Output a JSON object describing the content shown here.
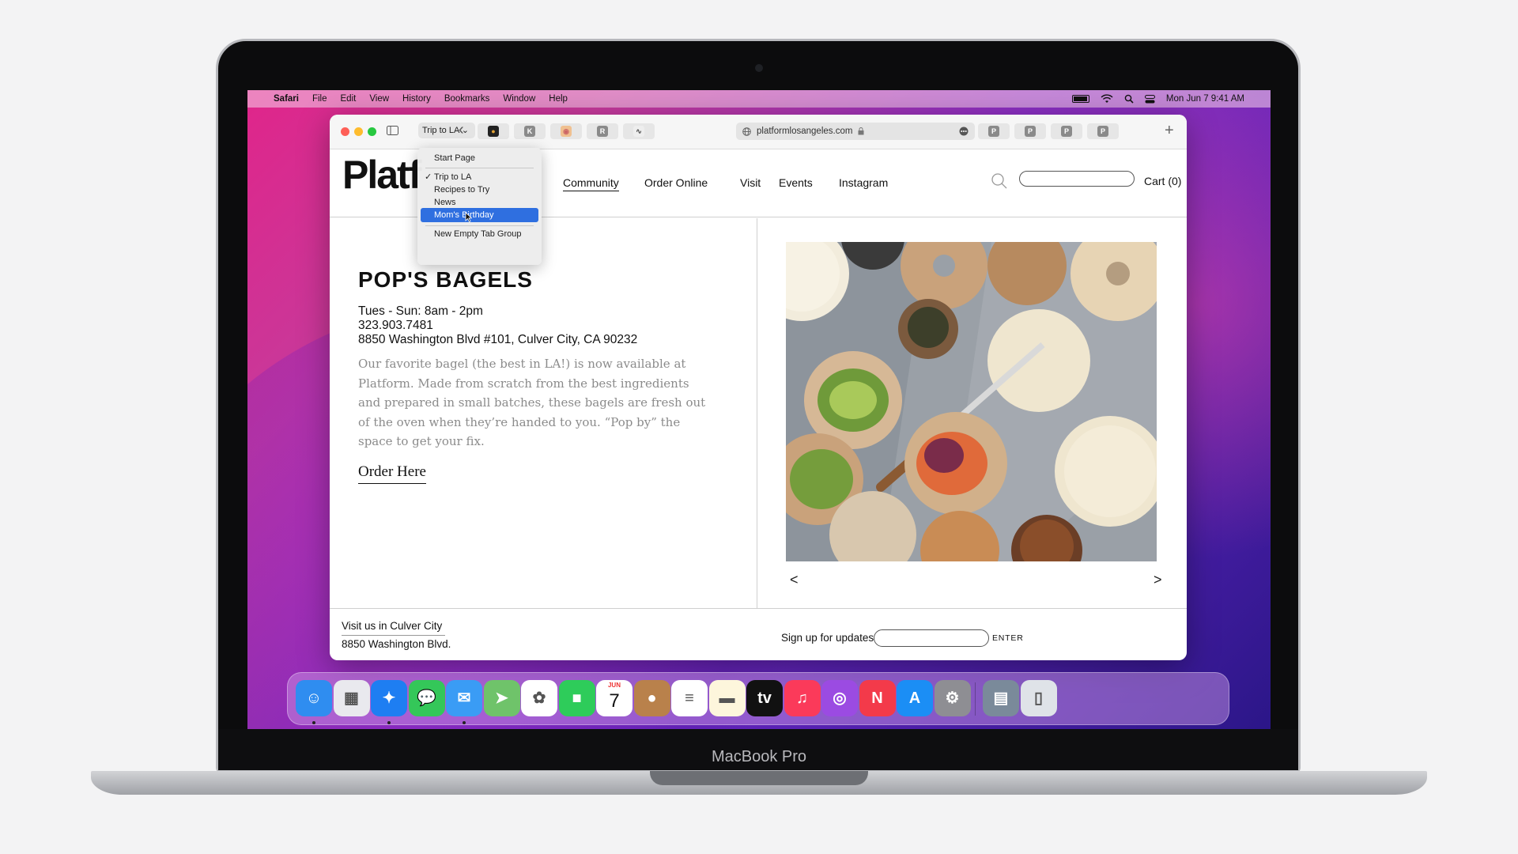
{
  "device": {
    "label": "MacBook Pro"
  },
  "menubar": {
    "apple": "",
    "app": "Safari",
    "items": [
      "File",
      "Edit",
      "View",
      "History",
      "Bookmarks",
      "Window",
      "Help"
    ],
    "datetime": "Mon Jun 7  9:41 AM"
  },
  "toolbar": {
    "tab_group": "Trip to LA",
    "back": "‹",
    "url": "platformlosangeles.com",
    "new_tab": "+",
    "tabs": [
      {
        "icon": "●",
        "color": "#d8a030"
      },
      {
        "icon": "K",
        "color": "#7a7a7a"
      },
      {
        "icon": "◉",
        "color": "#e6a060"
      },
      {
        "icon": "R",
        "color": "#7a7a7a"
      },
      {
        "icon": "∿",
        "color": "#7a7a7a"
      }
    ],
    "right_tabs": [
      "P",
      "P",
      "P",
      "P"
    ]
  },
  "tab_group_menu": {
    "items": [
      {
        "label": "Start Page"
      },
      {
        "label": "Trip to LA",
        "checked": "✓"
      },
      {
        "label": "Recipes to Try"
      },
      {
        "label": "News"
      },
      {
        "label": "Mom's Birthday",
        "highlighted": true
      },
      {
        "label": "New Empty Tab Group"
      }
    ]
  },
  "site": {
    "logo": "Platf",
    "nav": [
      "Community",
      "Order Online",
      "Visit",
      "Events",
      "Instagram"
    ],
    "cart": "Cart (0)",
    "title": "POP'S BAGELS",
    "hours": "Tues - Sun: 8am - 2pm",
    "phone": "323.903.7481",
    "address": "8850 Washington Blvd #101, Culver City, CA 90232",
    "description": "Our favorite bagel (the best in LA!) is now available at Platform. Made from scratch from the best ingredients and prepared in small batches, these bagels are fresh out of the oven when they’re handed to you. “Pop by” the space to get your fix.",
    "order_link": "Order Here",
    "prev": "<",
    "next": ">",
    "footer": {
      "visit": "Visit us in Culver City",
      "street": "8850 Washington Blvd.",
      "signup": "Sign up for updates",
      "enter": "ENTER"
    }
  },
  "dock": {
    "apps": [
      {
        "name": "Finder",
        "glyph": "☺",
        "color": "#2f8df0"
      },
      {
        "name": "Launchpad",
        "glyph": "▦",
        "color": "#e9e9ee"
      },
      {
        "name": "Safari",
        "glyph": "✦",
        "color": "#1e7ef2"
      },
      {
        "name": "Messages",
        "glyph": "💬",
        "color": "#34c759"
      },
      {
        "name": "Mail",
        "glyph": "✉",
        "color": "#3a9cf5"
      },
      {
        "name": "Maps",
        "glyph": "➤",
        "color": "#6fc36a"
      },
      {
        "name": "Photos",
        "glyph": "✿",
        "color": "#ffffff"
      },
      {
        "name": "FaceTime",
        "glyph": "■",
        "color": "#2ecc5a"
      },
      {
        "name": "Calendar",
        "glyph": "7",
        "color": "#ffffff",
        "month": "JUN"
      },
      {
        "name": "Contacts",
        "glyph": "●",
        "color": "#b9814b"
      },
      {
        "name": "Reminders",
        "glyph": "≡",
        "color": "#ffffff"
      },
      {
        "name": "Notes",
        "glyph": "▬",
        "color": "#fdf6dc"
      },
      {
        "name": "TV",
        "glyph": "tv",
        "color": "#111111"
      },
      {
        "name": "Music",
        "glyph": "♫",
        "color": "#fb3a5a"
      },
      {
        "name": "Podcasts",
        "glyph": "◎",
        "color": "#9b4be2"
      },
      {
        "name": "News",
        "glyph": "N",
        "color": "#f33a4a"
      },
      {
        "name": "App Store",
        "glyph": "A",
        "color": "#1b8ef5"
      },
      {
        "name": "System Preferences",
        "glyph": "⚙",
        "color": "#8e8e93"
      },
      {
        "name": "Downloads",
        "glyph": "▤",
        "color": "#7a8a9a"
      },
      {
        "name": "Trash",
        "glyph": "▯",
        "color": "#dfe3e8"
      }
    ]
  }
}
